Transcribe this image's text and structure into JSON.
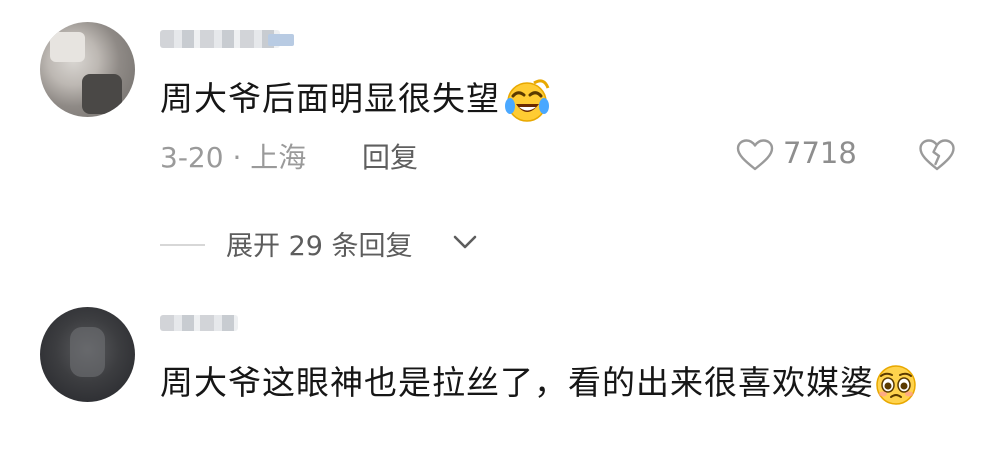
{
  "comments": [
    {
      "text": "周大爷后面明显很失望",
      "emoji": "rolling-laugh-emoji",
      "date_location": "3-20 · 上海",
      "reply_label": "回复",
      "like_count": "7718"
    },
    {
      "text": "周大爷这眼神也是拉丝了，看的出来很喜欢媒婆",
      "emoji": "pleading-face-emoji"
    }
  ],
  "thread": {
    "expand_label": "展开 29 条回复"
  },
  "icons": {
    "like": "heart-outline-icon",
    "dislike": "broken-heart-icon",
    "expand": "chevron-down-icon"
  },
  "colors": {
    "text_primary": "#161616",
    "text_secondary": "#9a9a9a",
    "background": "#ffffff"
  }
}
